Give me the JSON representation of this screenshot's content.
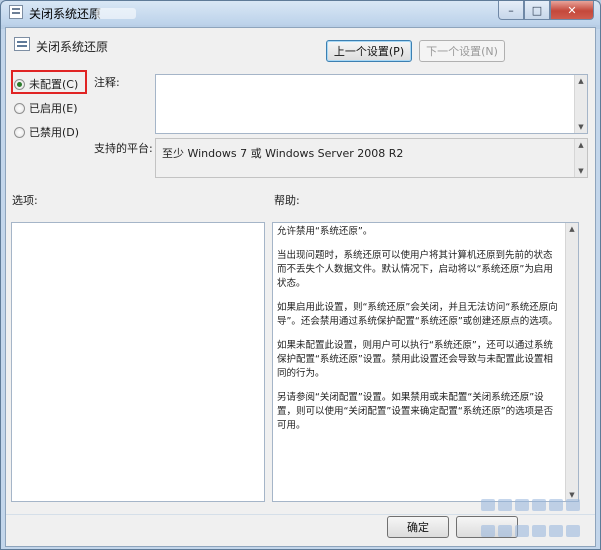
{
  "window": {
    "title": "关闭系统还原",
    "buttons": {
      "minimize": "–",
      "maximize": "□",
      "close": "✕"
    }
  },
  "header": {
    "title": "关闭系统还原"
  },
  "nav": {
    "prev_label": "上一个设置(P)",
    "next_label": "下一个设置(N)"
  },
  "radios": [
    {
      "label": "未配置(C)",
      "checked": true
    },
    {
      "label": "已启用(E)",
      "checked": false
    },
    {
      "label": "已禁用(D)",
      "checked": false
    }
  ],
  "comment": {
    "label": "注释:",
    "value": ""
  },
  "platform": {
    "label": "支持的平台:",
    "value": "至少 Windows 7 或 Windows Server 2008 R2"
  },
  "options": {
    "label": "选项:"
  },
  "help": {
    "label": "帮助:",
    "paragraphs": [
      "允许禁用“系统还原”。",
      "当出现问题时，系统还原可以使用户将其计算机还原到先前的状态而不丢失个人数据文件。默认情况下，启动将以“系统还原”为启用状态。",
      "如果启用此设置，则“系统还原”会关闭，并且无法访问“系统还原向导”。还会禁用通过系统保护配置“系统还原”或创建还原点的选项。",
      "如果未配置此设置，则用户可以执行“系统还原”，还可以通过系统保护配置“系统还原”设置。禁用此设置还会导致与未配置此设置相同的行为。",
      "另请参阅“关闭配置”设置。如果禁用或未配置“关闭系统还原”设置，则可以使用“关闭配置”设置来确定配置“系统还原”的选项是否可用。"
    ]
  },
  "footer": {
    "ok_label": "确定",
    "cancel_label": ""
  },
  "colors": {
    "highlight": "#e02424",
    "titlebar": "#bcd2ea",
    "client_bg": "#f0f0f0"
  }
}
